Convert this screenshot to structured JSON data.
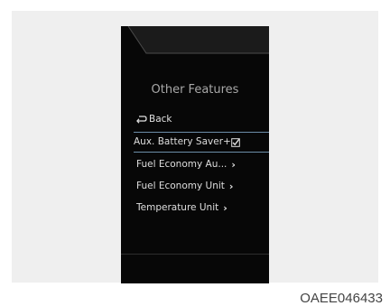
{
  "screen": {
    "title": "Other Features",
    "back_label": "Back",
    "items": [
      {
        "label": "Aux. Battery Saver+",
        "selected": true,
        "checked": true
      },
      {
        "label": "Fuel Economy Au...",
        "selected": false
      },
      {
        "label": "Fuel Economy Unit",
        "selected": false
      },
      {
        "label": "Temperature Unit",
        "selected": false
      }
    ]
  },
  "figure": {
    "code": "OAEE046433"
  },
  "colors": {
    "screen_background": "#070707",
    "text": "#dedede",
    "title": "#a8a8a8",
    "selection_line": "#6c8da8",
    "panel": "#efefef"
  },
  "icons": {
    "back": "back-arrow-icon",
    "checkbox": "checkbox-checked-icon",
    "chevron": "chevron-right-icon"
  }
}
